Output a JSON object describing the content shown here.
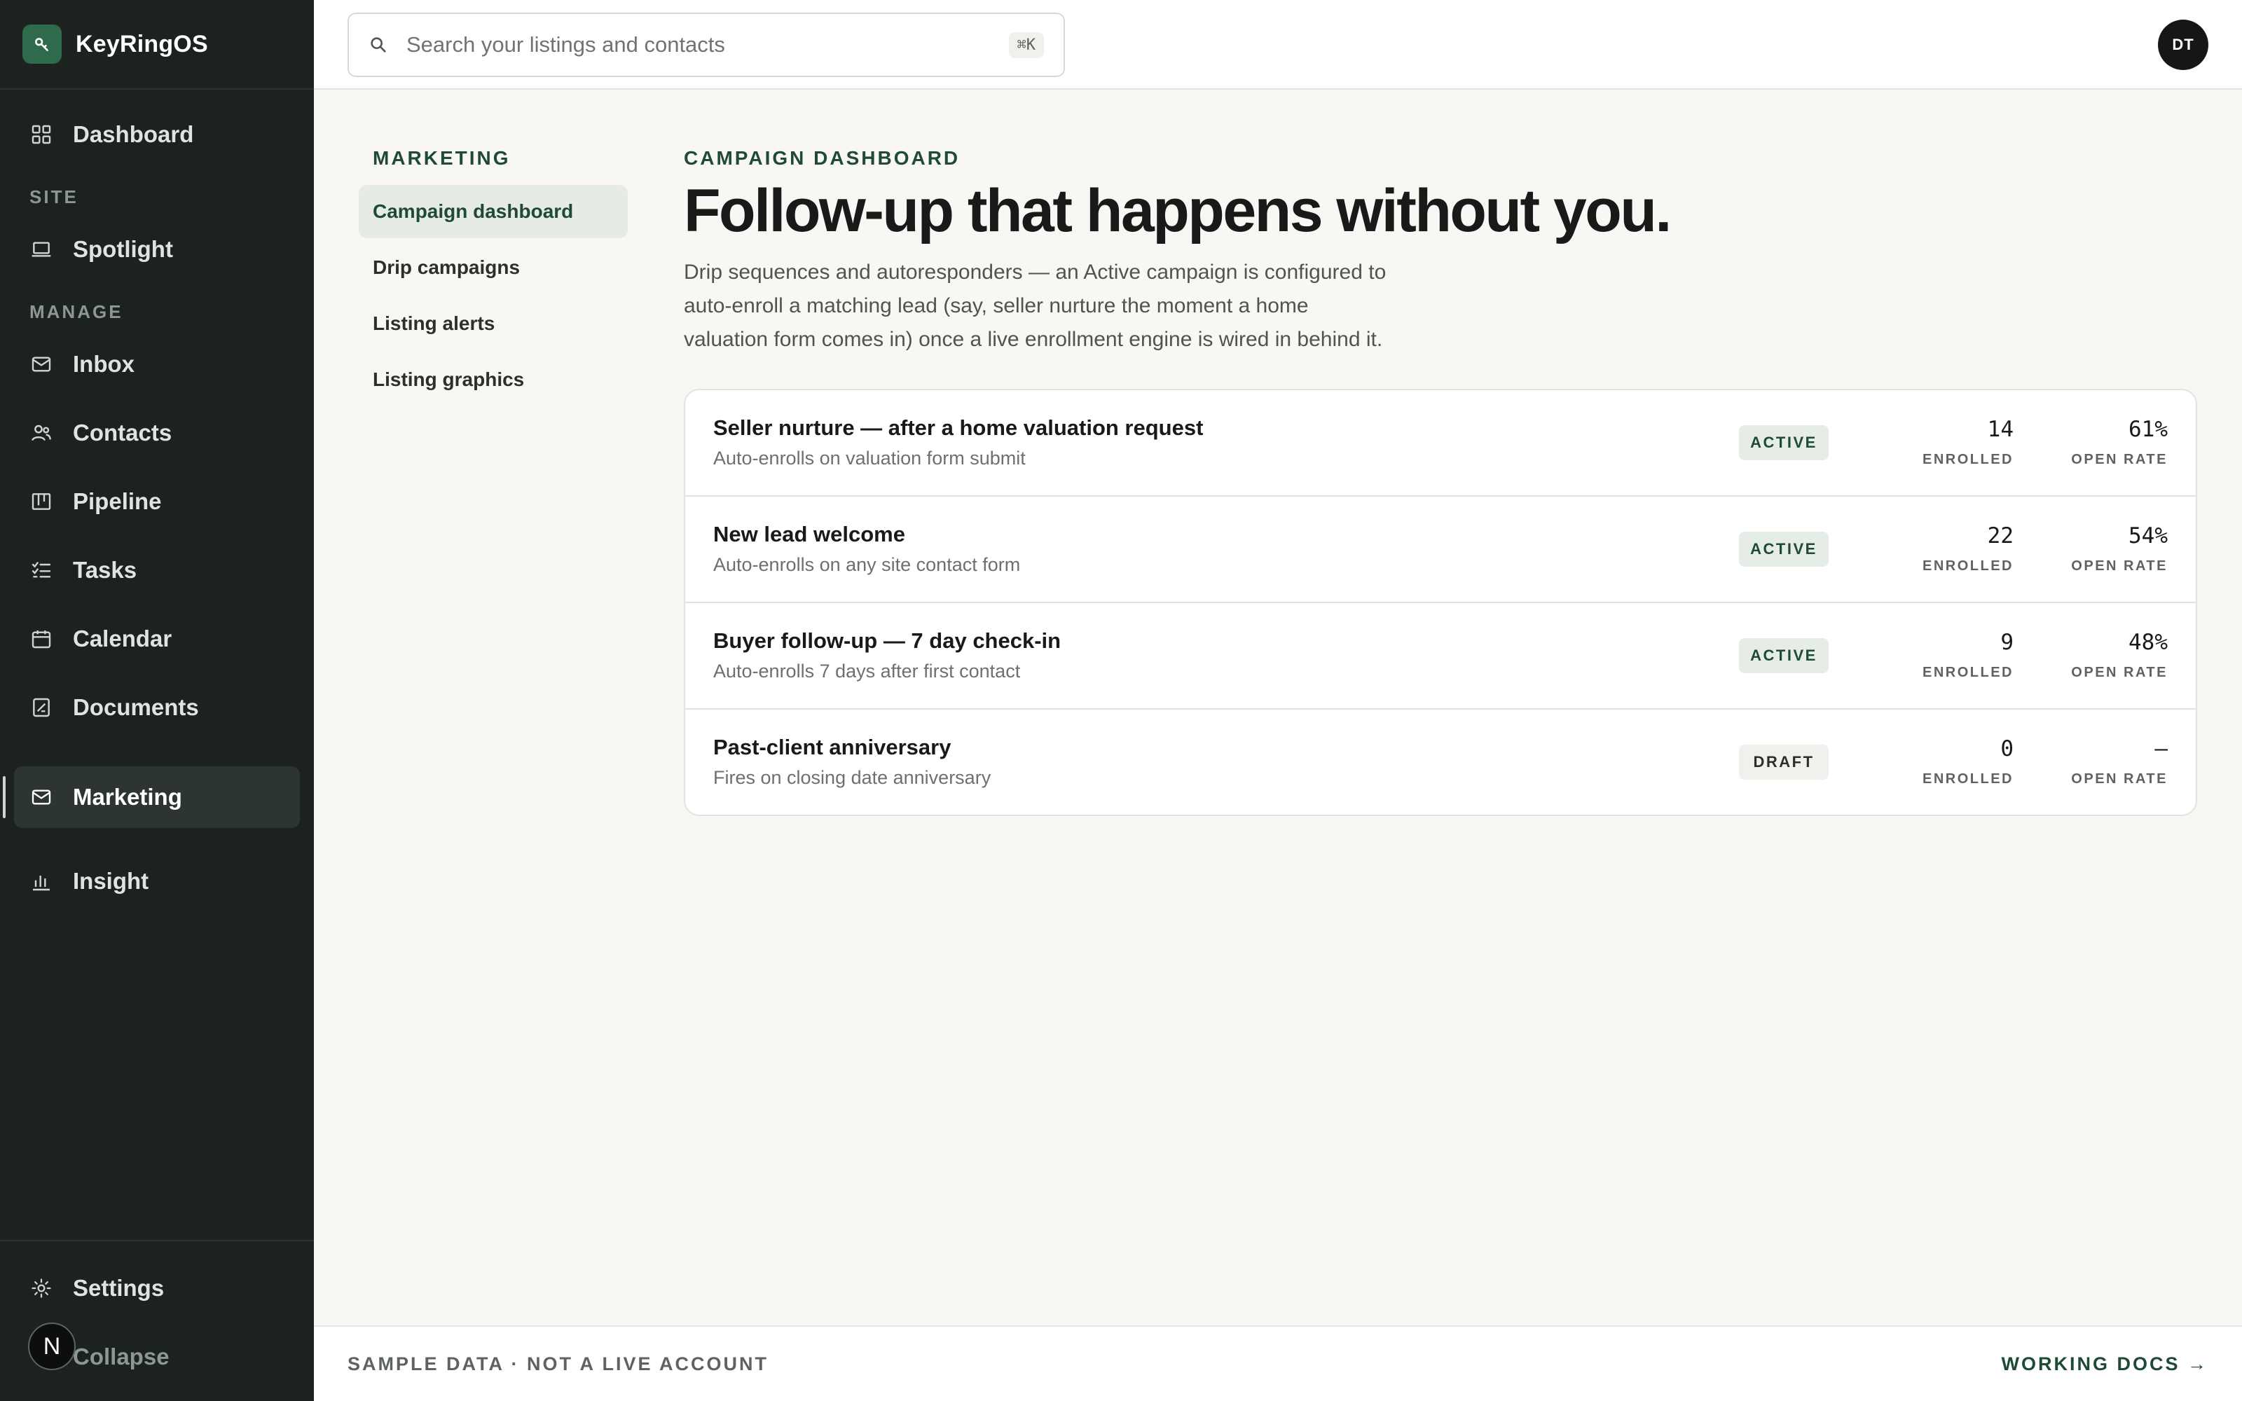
{
  "app": {
    "name": "KeyRingOS",
    "logo_icon": "key-icon",
    "accent_color": "#2e6a4b"
  },
  "sidebar": {
    "primary": [
      {
        "label": "Dashboard",
        "icon": "grid-icon"
      }
    ],
    "sections": [
      {
        "title": "SITE",
        "items": [
          {
            "label": "Spotlight",
            "icon": "laptop-icon"
          }
        ]
      },
      {
        "title": "MANAGE",
        "items": [
          {
            "label": "Inbox",
            "icon": "mail-icon"
          },
          {
            "label": "Contacts",
            "icon": "users-icon"
          },
          {
            "label": "Pipeline",
            "icon": "kanban-icon"
          },
          {
            "label": "Tasks",
            "icon": "checklist-icon"
          },
          {
            "label": "Calendar",
            "icon": "calendar-icon"
          },
          {
            "label": "Documents",
            "icon": "document-icon"
          }
        ]
      }
    ],
    "marketing": {
      "label": "Marketing",
      "icon": "mail-icon",
      "active": true
    },
    "insight": {
      "label": "Insight",
      "icon": "bar-chart-icon"
    },
    "settings": {
      "label": "Settings",
      "icon": "gear-icon"
    },
    "collapse": {
      "label": "Collapse"
    },
    "badge": "N"
  },
  "topbar": {
    "search_placeholder": "Search your listings and contacts",
    "search_shortcut": "⌘K",
    "avatar_initials": "DT"
  },
  "subnav": {
    "title": "MARKETING",
    "items": [
      {
        "label": "Campaign dashboard",
        "active": true
      },
      {
        "label": "Drip campaigns"
      },
      {
        "label": "Listing alerts"
      },
      {
        "label": "Listing graphics"
      }
    ]
  },
  "main": {
    "eyebrow": "CAMPAIGN DASHBOARD",
    "headline": "Follow-up that happens without you.",
    "description": "Drip sequences and autoresponders — an Active campaign is configured to auto-enroll a matching lead (say, seller nurture the moment a home valuation form comes in) once a live enrollment engine is wired in behind it.",
    "metric_labels": {
      "enrolled": "ENROLLED",
      "open_rate": "OPEN RATE"
    },
    "campaigns": [
      {
        "title": "Seller nurture — after a home valuation request",
        "subtitle": "Auto-enrolls on valuation form submit",
        "status": "ACTIVE",
        "enrolled": "14",
        "open_rate": "61%"
      },
      {
        "title": "New lead welcome",
        "subtitle": "Auto-enrolls on any site contact form",
        "status": "ACTIVE",
        "enrolled": "22",
        "open_rate": "54%"
      },
      {
        "title": "Buyer follow-up — 7 day check-in",
        "subtitle": "Auto-enrolls 7 days after first contact",
        "status": "ACTIVE",
        "enrolled": "9",
        "open_rate": "48%"
      },
      {
        "title": "Past-client anniversary",
        "subtitle": "Fires on closing date anniversary",
        "status": "DRAFT",
        "enrolled": "0",
        "open_rate": "—"
      }
    ]
  },
  "footer": {
    "note": "SAMPLE DATA · NOT A LIVE ACCOUNT",
    "link": "WORKING DOCS →"
  }
}
